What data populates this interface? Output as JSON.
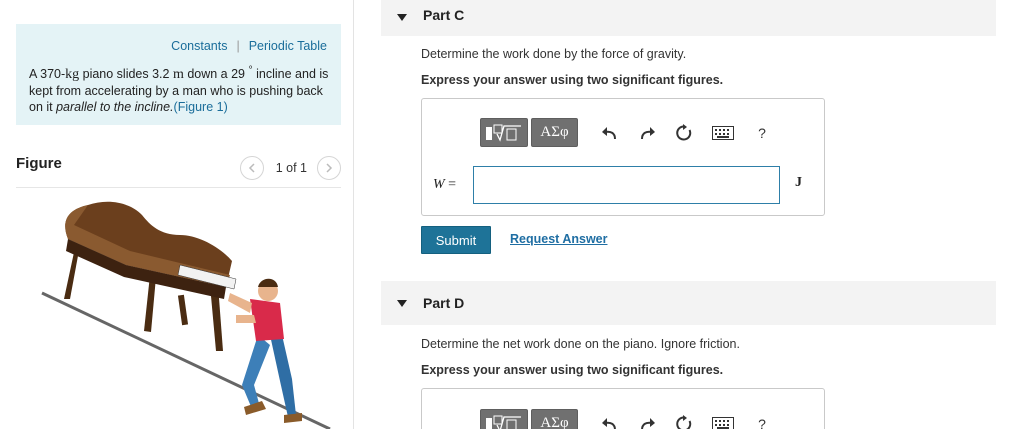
{
  "left": {
    "links": {
      "constants": "Constants",
      "separator": "|",
      "periodic_table": "Periodic Table"
    },
    "problem": {
      "t1": "A 370-",
      "kg": "kg",
      "t2": " piano slides 3.2 ",
      "m": "m",
      "t3": " down a 29 ",
      "deg": "°",
      "t4": " incline and is kept from accelerating by a man who is pushing back on it ",
      "italic": "parallel to the incline.",
      "fig_link": "(Figure 1)"
    },
    "figure": {
      "label": "Figure",
      "pager_text": "1 of 1"
    }
  },
  "part_c": {
    "title": "Part C",
    "question": "Determine the work done by the force of gravity.",
    "instruction": "Express your answer using two significant figures.",
    "toolbar": {
      "greek": "ΑΣφ",
      "help": "?"
    },
    "variable": "W",
    "equals": " =",
    "unit": "J",
    "answer_value": "",
    "submit": "Submit",
    "request_answer": "Request Answer"
  },
  "part_d": {
    "title": "Part D",
    "question": "Determine the net work done on the piano. Ignore friction.",
    "instruction": "Express your answer using two significant figures.",
    "toolbar": {
      "greek": "ΑΣφ",
      "help": "?"
    }
  },
  "colors": {
    "accent": "#1e7398",
    "link": "#1a6d9a",
    "problem_bg": "#e4f3f6",
    "header_bg": "#f3f3f3"
  }
}
